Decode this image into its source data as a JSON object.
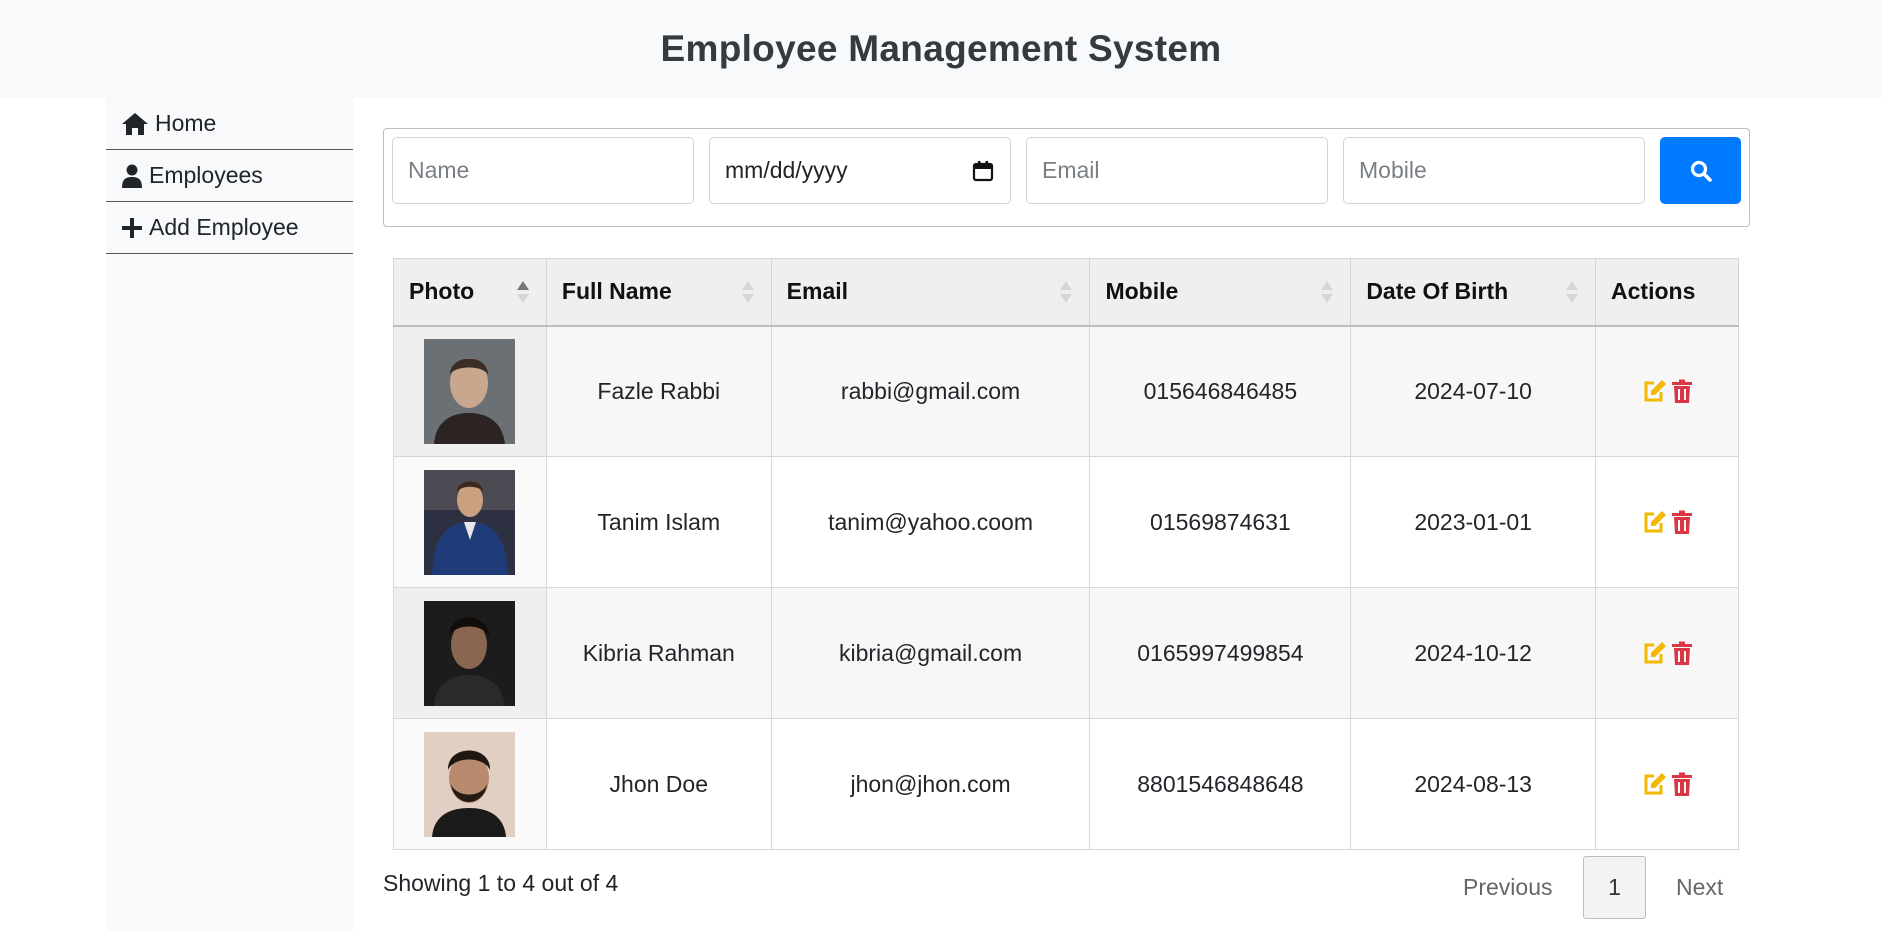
{
  "header": {
    "title": "Employee Management System"
  },
  "sidebar": {
    "items": [
      {
        "label": "Home",
        "icon": "home-icon"
      },
      {
        "label": "Employees",
        "icon": "user-icon"
      },
      {
        "label": "Add Employee",
        "icon": "plus-icon"
      }
    ]
  },
  "search": {
    "name_placeholder": "Name",
    "date_value": "mm/dd/yyyy",
    "email_placeholder": "Email",
    "mobile_placeholder": "Mobile",
    "button_icon": "search-icon"
  },
  "table": {
    "headers": [
      "Photo",
      "Full Name",
      "Email",
      "Mobile",
      "Date Of Birth",
      "Actions"
    ],
    "rows": [
      {
        "name": "Fazle Rabbi",
        "email": "rabbi@gmail.com",
        "mobile": "015646846485",
        "dob": "2024-07-10"
      },
      {
        "name": "Tanim Islam",
        "email": "tanim@yahoo.coom",
        "mobile": "01569874631",
        "dob": "2023-01-01"
      },
      {
        "name": "Kibria Rahman",
        "email": "kibria@gmail.com",
        "mobile": "0165997499854",
        "dob": "2024-10-12"
      },
      {
        "name": "Jhon Doe",
        "email": "jhon@jhon.com",
        "mobile": "8801546848648",
        "dob": "2024-08-13"
      }
    ]
  },
  "footer": {
    "info": "Showing 1 to 4 out of 4",
    "previous": "Previous",
    "page": "1",
    "next": "Next"
  },
  "colors": {
    "primary": "#007bff",
    "edit": "#f5b800",
    "delete": "#dc3545"
  }
}
